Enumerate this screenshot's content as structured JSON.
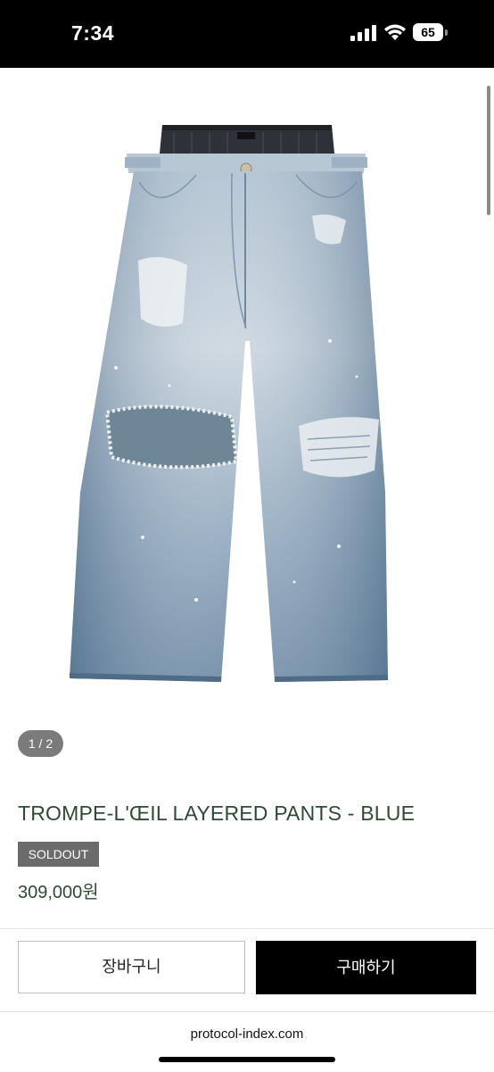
{
  "status_bar": {
    "time": "7:34",
    "battery_level": "65",
    "icons": [
      "signal-icon",
      "wifi-icon",
      "battery-icon"
    ]
  },
  "gallery": {
    "pager_text": "1 / 2",
    "image_icon": "jeans-product-image"
  },
  "product": {
    "title": "TROMPE-L'ŒIL LAYERED PANTS - BLUE",
    "badge": "SOLDOUT",
    "price": "309,000원"
  },
  "actions": {
    "cart_label": "장바구니",
    "buy_label": "구매하기"
  },
  "browser": {
    "url": "protocol-index.com"
  },
  "colors": {
    "title_text": "#2f4a33",
    "badge_bg": "#6b6b6b",
    "buy_bg": "#000000",
    "denim": "#7f9bb6"
  }
}
